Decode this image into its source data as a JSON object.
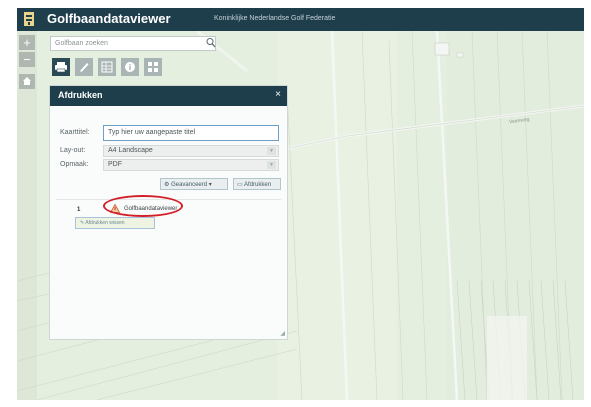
{
  "header": {
    "app_title": "Golfbaandataviewer",
    "org_title": "Koninklijke Nederlandse Golf Federatie"
  },
  "search": {
    "placeholder": "Golfbaan zoeken"
  },
  "map_controls": {
    "zoom_in": "+",
    "zoom_out": "−"
  },
  "print_panel": {
    "title": "Afdrukken",
    "close": "×",
    "title_label": "Kaarttitel:",
    "title_value": "Typ hier uw aangepaste titel",
    "layout_label": "Lay-out:",
    "layout_value": "A4 Landscape",
    "format_label": "Opmaak:",
    "format_value": "PDF",
    "advanced_button": "Geavanceerd",
    "print_button": "Afdrukken",
    "result_number": "1",
    "result_text": "Golfbaandataviewer",
    "clear_button": "Afdrukken wissen"
  },
  "map_labels": {
    "road": "Veenweg"
  }
}
